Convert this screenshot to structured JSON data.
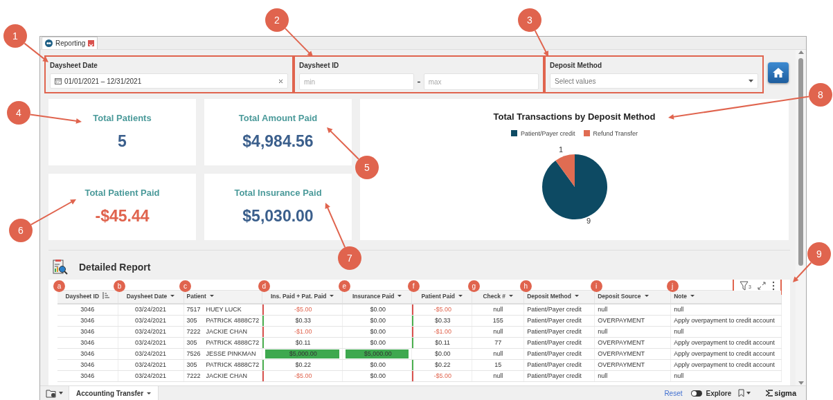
{
  "window": {
    "tab": {
      "label": "Reporting",
      "selected": true
    }
  },
  "filters": [
    {
      "kind": "date",
      "label": "Daysheet Date",
      "value": "01/01/2021 – 12/31/2021",
      "highlighted": true
    },
    {
      "kind": "range",
      "label": "Daysheet ID",
      "placeholder_min": "min",
      "separator": "-",
      "placeholder_max": "max",
      "highlighted": true
    },
    {
      "kind": "select",
      "label": "Deposit Method",
      "placeholder": "Select values",
      "highlighted": true
    }
  ],
  "metrics": [
    {
      "title": "Total Patients",
      "value": "5",
      "negative": false
    },
    {
      "title": "Total Amount Paid",
      "value": "$4,984.56",
      "negative": false
    },
    {
      "title": "Total Patient Paid",
      "value": "-$45.44",
      "negative": true
    },
    {
      "title": "Total Insurance Paid",
      "value": "$5,030.00",
      "negative": false
    }
  ],
  "chart": {
    "chart_data": {
      "type": "pie",
      "title": "Total Transactions by Deposit Method",
      "legend": "top",
      "categories": [
        "Patient/Payer credit",
        "Refund Transfer"
      ],
      "values": [
        9,
        1
      ],
      "colors": [
        "#0d4a63",
        "#e06c52"
      ],
      "data_labels": true
    }
  },
  "report": {
    "title": "Detailed Report",
    "filter_count": "3",
    "columns": [
      {
        "label": "Daysheet ID",
        "marker": "a",
        "sorted": true
      },
      {
        "label": "Daysheet Date",
        "marker": "b",
        "sorted": false
      },
      {
        "label": "Patient",
        "marker": "c",
        "sorted": false
      },
      {
        "label": "Ins. Paid + Pat. Paid",
        "marker": "d",
        "sorted": false
      },
      {
        "label": "Insurance Paid",
        "marker": "e",
        "sorted": false
      },
      {
        "label": "Patient Paid",
        "marker": "f",
        "sorted": false
      },
      {
        "label": "Check #",
        "marker": "g",
        "sorted": false
      },
      {
        "label": "Deposit Method",
        "marker": "h",
        "sorted": false
      },
      {
        "label": "Deposit Source",
        "marker": "i",
        "sorted": false
      },
      {
        "label": "Note",
        "marker": "j",
        "sorted": false
      }
    ],
    "rows": [
      {
        "id": "3046",
        "date": "03/24/2021",
        "patient_id": "7517",
        "patient_name": "HUEY LUCK",
        "total": {
          "text": "-$5.00",
          "negative": true,
          "bar": true,
          "highlighted": false
        },
        "insurance": {
          "text": "$0.00",
          "negative": false,
          "bar": false,
          "highlighted": false
        },
        "patient_paid": {
          "text": "-$5.00",
          "negative": true,
          "bar": true,
          "highlighted": false
        },
        "check": "null",
        "method": "Patient/Payer credit",
        "source": "null",
        "note": "null"
      },
      {
        "id": "3046",
        "date": "03/24/2021",
        "patient_id": "305",
        "patient_name": "PATRICK 4888C72",
        "total": {
          "text": "$0.33",
          "negative": false,
          "bar": true,
          "highlighted": false
        },
        "insurance": {
          "text": "$0.00",
          "negative": false,
          "bar": false,
          "highlighted": false
        },
        "patient_paid": {
          "text": "$0.33",
          "negative": false,
          "bar": true,
          "highlighted": false
        },
        "check": "155",
        "method": "Patient/Payer credit",
        "source": "OVERPAYMENT",
        "note": "Apply overpayment to credit account"
      },
      {
        "id": "3046",
        "date": "03/24/2021",
        "patient_id": "7222",
        "patient_name": "JACKIE CHAN",
        "total": {
          "text": "-$1.00",
          "negative": true,
          "bar": true,
          "highlighted": false
        },
        "insurance": {
          "text": "$0.00",
          "negative": false,
          "bar": false,
          "highlighted": false
        },
        "patient_paid": {
          "text": "-$1.00",
          "negative": true,
          "bar": true,
          "highlighted": false
        },
        "check": "null",
        "method": "Patient/Payer credit",
        "source": "null",
        "note": "null"
      },
      {
        "id": "3046",
        "date": "03/24/2021",
        "patient_id": "305",
        "patient_name": "PATRICK 4888C72",
        "total": {
          "text": "$0.11",
          "negative": false,
          "bar": true,
          "highlighted": false
        },
        "insurance": {
          "text": "$0.00",
          "negative": false,
          "bar": false,
          "highlighted": false
        },
        "patient_paid": {
          "text": "$0.11",
          "negative": false,
          "bar": true,
          "highlighted": false
        },
        "check": "77",
        "method": "Patient/Payer credit",
        "source": "OVERPAYMENT",
        "note": "Apply overpayment to credit account"
      },
      {
        "id": "3046",
        "date": "03/24/2021",
        "patient_id": "7526",
        "patient_name": "JESSE PINKMAN",
        "total": {
          "text": "$5,000.00",
          "negative": false,
          "bar": false,
          "highlighted": true
        },
        "insurance": {
          "text": "$5,000.00",
          "negative": false,
          "bar": false,
          "highlighted": true
        },
        "patient_paid": {
          "text": "$0.00",
          "negative": false,
          "bar": false,
          "highlighted": false
        },
        "check": "null",
        "method": "Patient/Payer credit",
        "source": "OVERPAYMENT",
        "note": "Apply overpayment to credit account"
      },
      {
        "id": "3046",
        "date": "03/24/2021",
        "patient_id": "305",
        "patient_name": "PATRICK 4888C72",
        "total": {
          "text": "$0.22",
          "negative": false,
          "bar": true,
          "highlighted": false
        },
        "insurance": {
          "text": "$0.00",
          "negative": false,
          "bar": false,
          "highlighted": false
        },
        "patient_paid": {
          "text": "$0.22",
          "negative": false,
          "bar": true,
          "highlighted": false
        },
        "check": "15",
        "method": "Patient/Payer credit",
        "source": "OVERPAYMENT",
        "note": "Apply overpayment to credit account"
      },
      {
        "id": "3046",
        "date": "03/24/2021",
        "patient_id": "7222",
        "patient_name": "JACKIE CHAN",
        "total": {
          "text": "-$5.00",
          "negative": true,
          "bar": true,
          "highlighted": false
        },
        "insurance": {
          "text": "$0.00",
          "negative": false,
          "bar": false,
          "highlighted": false
        },
        "patient_paid": {
          "text": "-$5.00",
          "negative": true,
          "bar": true,
          "highlighted": false
        },
        "check": "null",
        "method": "Patient/Payer credit",
        "source": "null",
        "note": "null"
      }
    ]
  },
  "footer": {
    "page_tab": "Accounting Transfer",
    "reset": "Reset",
    "explore": {
      "label": "Explore",
      "on": false
    },
    "brand": "sigma"
  },
  "callouts": [
    {
      "label": "1"
    },
    {
      "label": "2"
    },
    {
      "label": "3"
    },
    {
      "label": "4"
    },
    {
      "label": "5"
    },
    {
      "label": "6"
    },
    {
      "label": "7"
    },
    {
      "label": "8"
    },
    {
      "label": "9"
    }
  ]
}
